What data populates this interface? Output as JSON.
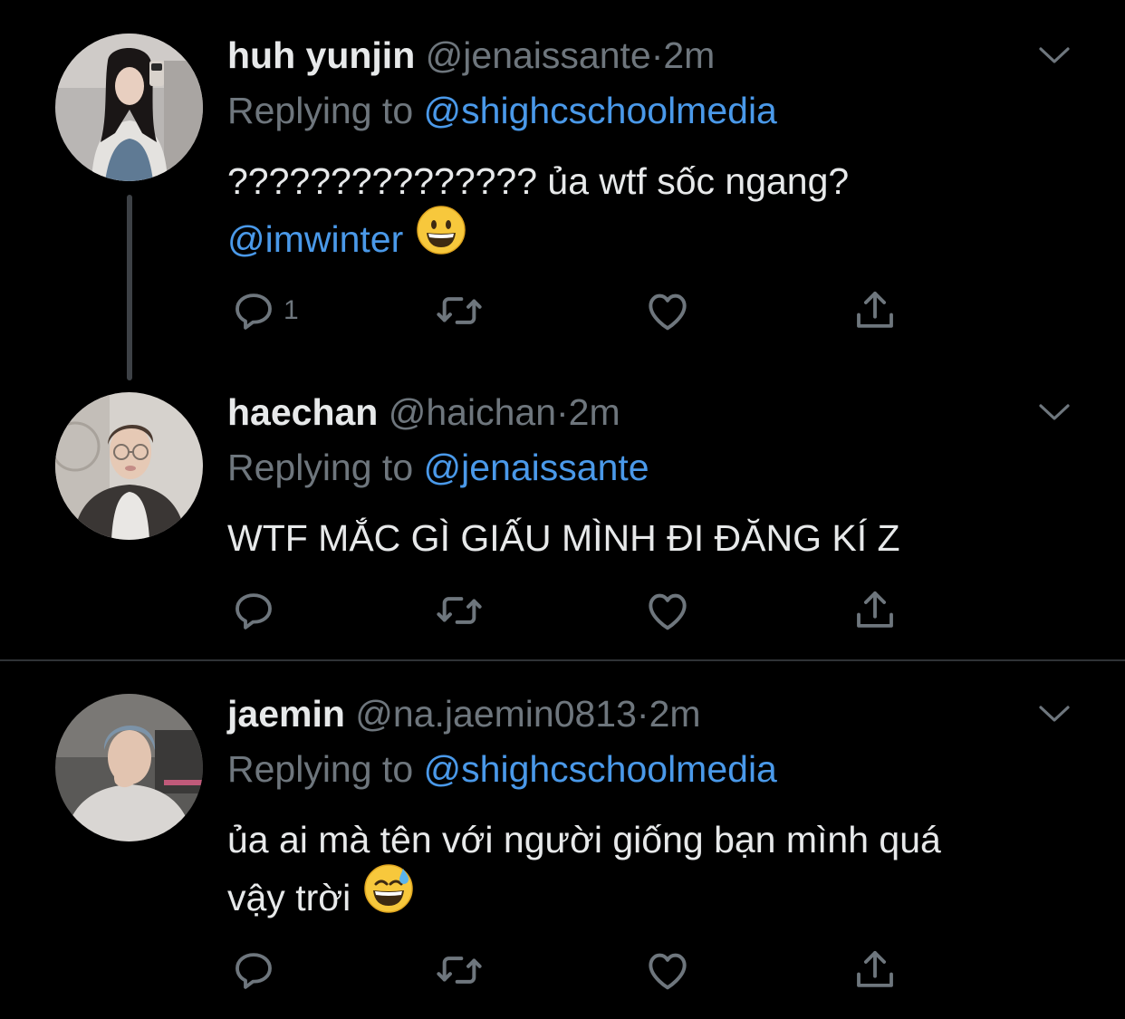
{
  "tweets": [
    {
      "name": "huh yunjin",
      "handle": "@jenaissante",
      "dot": "·",
      "time": "2m",
      "reply_prefix": "Replying to",
      "reply_to": "@shighcschoolmedia",
      "text_line1": "??????????????? ủa wtf sốc ngang?",
      "text_mention": "@imwinter",
      "emoji": "grinning-face",
      "reply_count": "1"
    },
    {
      "name": "haechan",
      "handle": "@haichan",
      "dot": "·",
      "time": "2m",
      "reply_prefix": "Replying to",
      "reply_to": "@jenaissante",
      "text_line1": "WTF MẮC GÌ GIẤU MÌNH ĐI ĐĂNG KÍ Z",
      "reply_count": ""
    },
    {
      "name": "jaemin",
      "handle": "@na.jaemin0813",
      "dot": "·",
      "time": "2m",
      "reply_prefix": "Replying to",
      "reply_to": "@shighcschoolmedia",
      "text_line1": "ủa ai mà tên với người giống bạn mình quá",
      "text_line2": "vậy trời",
      "emoji": "grinning-face-with-sweat",
      "reply_count": ""
    }
  ],
  "icons": {
    "reply": "reply-icon",
    "retweet": "retweet-icon",
    "like": "like-icon",
    "share": "share-icon",
    "caret": "chevron-down-icon"
  },
  "colors": {
    "background": "#000000",
    "text": "#e7e9ea",
    "muted": "#6e767d",
    "link": "#4a99e9",
    "divider": "#2f3336"
  }
}
